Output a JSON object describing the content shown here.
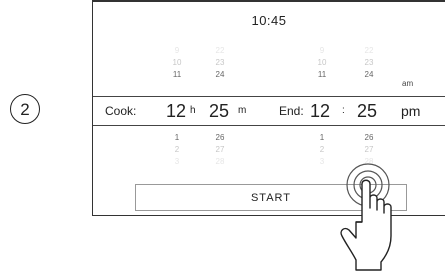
{
  "step_number": "2",
  "display": {
    "clock_time": "10:45",
    "cook": {
      "label": "Cook:",
      "hours": "12",
      "hours_unit": "h",
      "minutes": "25",
      "minutes_unit": "m",
      "hours_above": [
        "9",
        "10",
        "11"
      ],
      "hours_below": [
        "1",
        "2",
        "3"
      ],
      "minutes_above": [
        "22",
        "23",
        "24"
      ],
      "minutes_below": [
        "26",
        "27",
        "28"
      ]
    },
    "end": {
      "label": "End:",
      "hours": "12",
      "separator": ":",
      "minutes": "25",
      "period": "pm",
      "period_above": "am",
      "hours_above": [
        "9",
        "10",
        "11"
      ],
      "hours_below": [
        "1",
        "2",
        "3"
      ],
      "minutes_above": [
        "22",
        "23",
        "24"
      ],
      "minutes_below": [
        "26",
        "27",
        "28"
      ]
    },
    "start_label": "START"
  },
  "icons": {
    "touch_hand": "hand-pointer-icon",
    "touch_ripple": "touch-ripple-icon"
  }
}
